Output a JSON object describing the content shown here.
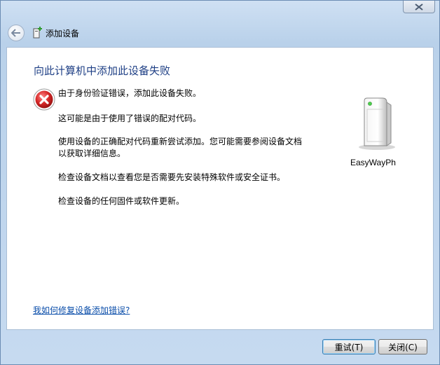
{
  "window": {
    "title": "添加设备"
  },
  "main": {
    "heading": "向此计算机中添加此设备失败",
    "messages": [
      "由于身份验证错误，添加此设备失败。",
      "这可能是由于使用了错误的配对代码。",
      "使用设备的正确配对代码重新尝试添加。您可能需要参阅设备文档",
      "以获取详细信息。",
      "检查设备文档以查看您是否需要先安装特殊软件或安全证书。",
      "检查设备的任何固件或软件更新。"
    ],
    "device_name": "EasyWayPh",
    "help_link": "我如何修复设备添加错误?"
  },
  "footer": {
    "retry_label": "重试(T)",
    "close_label": "关闭(C)"
  },
  "colors": {
    "heading": "#1e3f85",
    "link": "#0b4eaa",
    "error_red": "#d32020"
  },
  "icons": {
    "back": "back-arrow-icon",
    "app": "add-device-icon",
    "error": "error-icon",
    "device": "device-tower-icon",
    "close": "close-icon"
  }
}
